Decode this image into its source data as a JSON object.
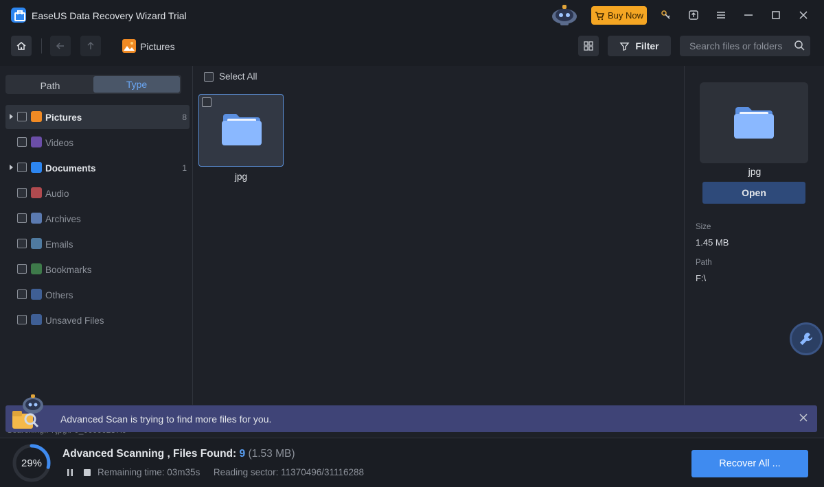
{
  "window": {
    "title": "EaseUS Data Recovery Wizard Trial",
    "buy_label": "Buy Now"
  },
  "toolbar": {
    "breadcrumb": "Pictures",
    "filter_label": "Filter",
    "search_placeholder": "Search files or folders"
  },
  "left_panel": {
    "tabs": [
      {
        "label": "Path",
        "active": false
      },
      {
        "label": "Type",
        "active": true
      }
    ],
    "types": [
      {
        "label": "Pictures",
        "count": "8",
        "expandable": true,
        "bright": true,
        "icon": "pictures-icon",
        "color": "#f08a24"
      },
      {
        "label": "Videos",
        "count": "",
        "expandable": false,
        "bright": false,
        "icon": "videos-icon",
        "color": "#6b4ea8"
      },
      {
        "label": "Documents",
        "count": "1",
        "expandable": true,
        "bright": true,
        "icon": "documents-icon",
        "color": "#2d86f0"
      },
      {
        "label": "Audio",
        "count": "",
        "expandable": false,
        "bright": false,
        "icon": "audio-icon",
        "color": "#b04a4f"
      },
      {
        "label": "Archives",
        "count": "",
        "expandable": false,
        "bright": false,
        "icon": "archives-icon",
        "color": "#5b7ab0"
      },
      {
        "label": "Emails",
        "count": "",
        "expandable": false,
        "bright": false,
        "icon": "emails-icon",
        "color": "#4f7aa0"
      },
      {
        "label": "Bookmarks",
        "count": "",
        "expandable": false,
        "bright": false,
        "icon": "bookmarks-icon",
        "color": "#3e7a4a"
      },
      {
        "label": "Others",
        "count": "",
        "expandable": false,
        "bright": false,
        "icon": "others-icon",
        "color": "#3f5f95"
      },
      {
        "label": "Unsaved Files",
        "count": "",
        "expandable": false,
        "bright": false,
        "icon": "unsaved-files-icon",
        "color": "#3f5f95"
      }
    ]
  },
  "center": {
    "select_all_label": "Select All",
    "items": [
      {
        "name": "jpg",
        "icon": "folder-icon"
      }
    ]
  },
  "right_panel": {
    "preview_name": "jpg",
    "open_label": "Open",
    "size_label": "Size",
    "size_value": "1.45 MB",
    "path_label": "Path",
    "path_value": "F:\\"
  },
  "banner": {
    "text": "Advanced Scan is trying to find more files for you.",
    "scan_path": "Searching:F:\\jpg\\F0_00000237.J"
  },
  "status": {
    "progress_percent": 29,
    "progress_label": "29%",
    "title_prefix": "Advanced Scanning , Files Found: ",
    "files_found": "9",
    "total_size": "(1.53 MB)",
    "remaining": "Remaining time: 03m35s",
    "sector": "Reading sector: 11370496/31116288",
    "recover_label": "Recover All ..."
  },
  "colors": {
    "accent": "#3f8bf0",
    "buy": "#f5a623",
    "banner": "#3f4477",
    "folder": "#6aa7f5"
  }
}
